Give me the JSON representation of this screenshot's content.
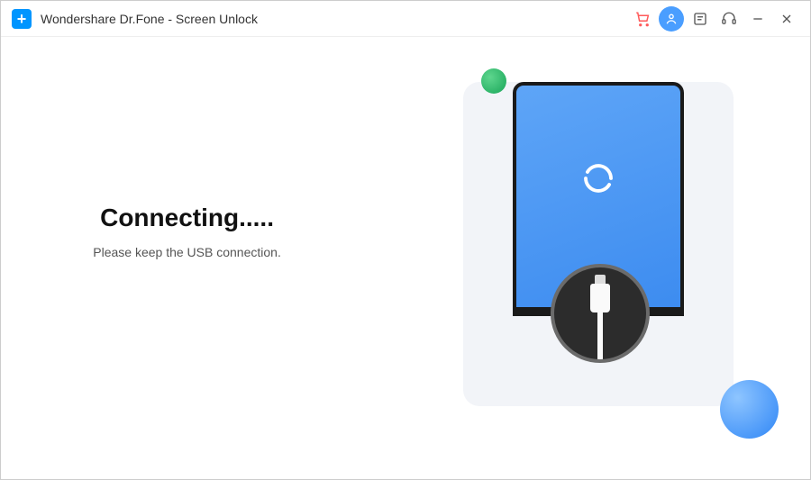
{
  "titlebar": {
    "title": "Wondershare Dr.Fone - Screen Unlock"
  },
  "main": {
    "heading": "Connecting.....",
    "subtext": "Please keep the USB connection."
  }
}
